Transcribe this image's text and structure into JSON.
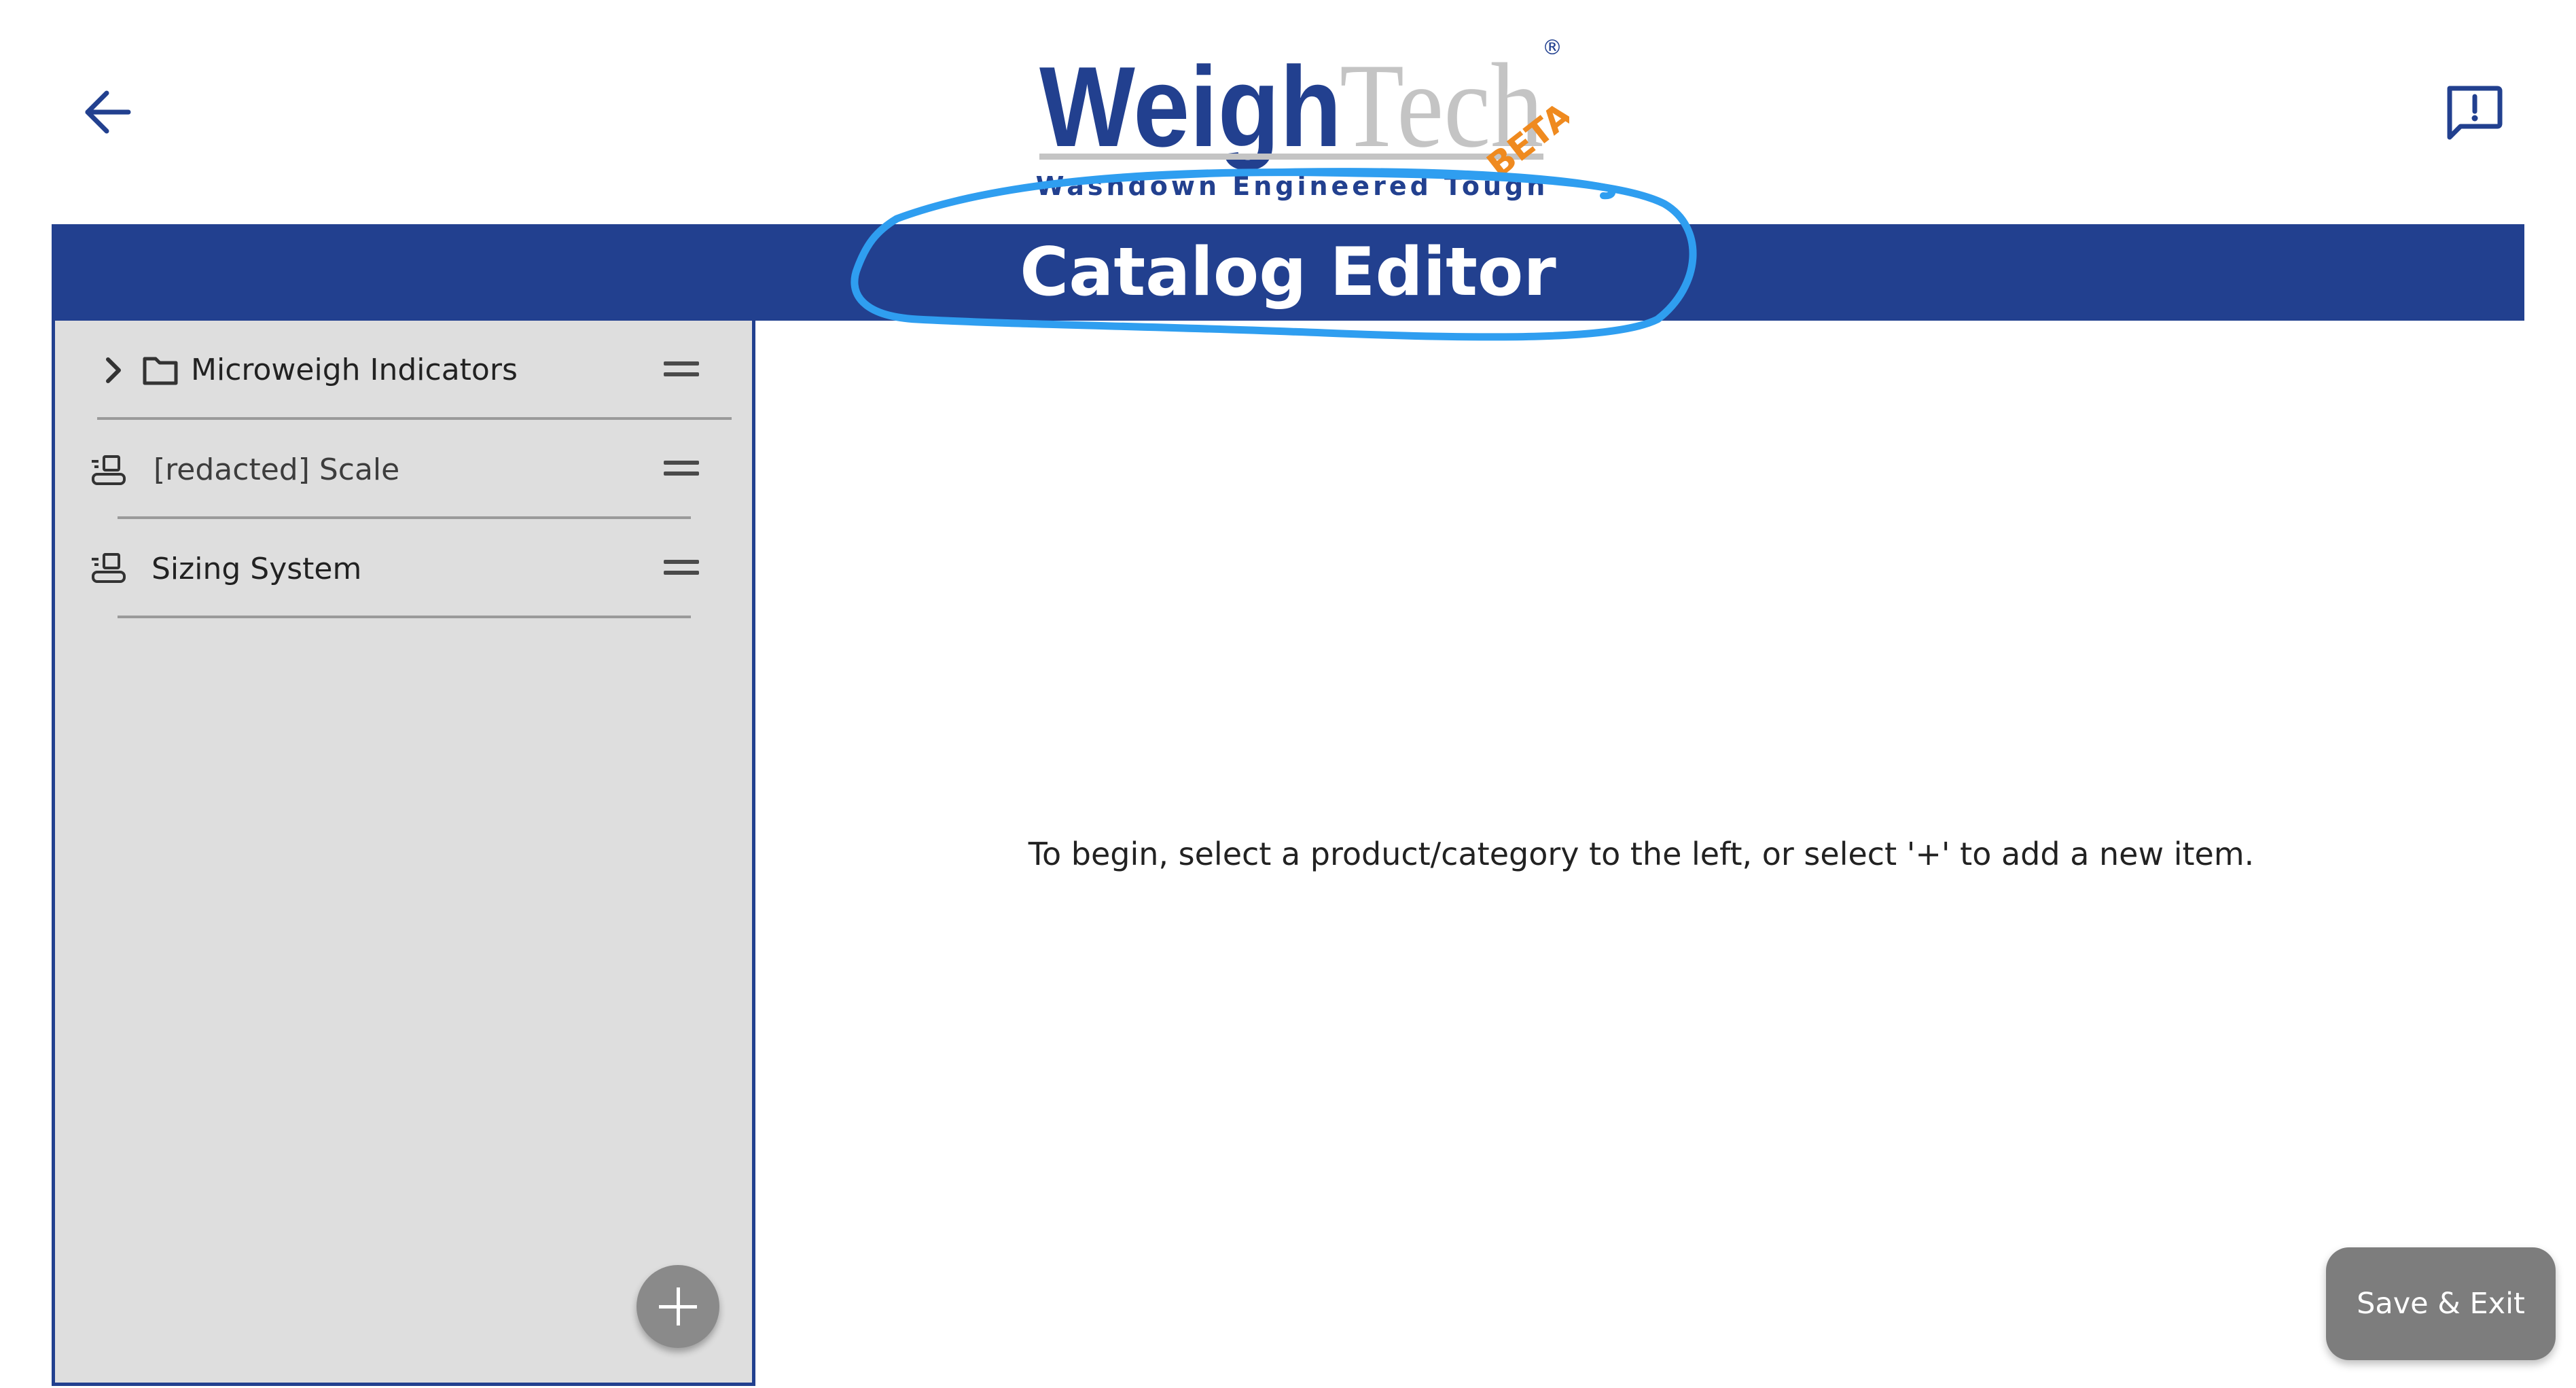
{
  "header": {
    "back_icon": "arrow-left-icon",
    "feedback_icon": "feedback-chat-icon",
    "logo": {
      "brand_primary": "Weigh",
      "brand_secondary": "Tech",
      "registered_mark": "®",
      "badge": "BETA",
      "tagline": "Washdown Engineered Tough"
    },
    "accent_color": "#22408f"
  },
  "title_bar": {
    "title": "Catalog Editor"
  },
  "sidebar": {
    "items": [
      {
        "label": "Microweigh Indicators",
        "type": "category",
        "icon": "folder-icon",
        "expand_icon": "chevron-right-icon"
      },
      {
        "label": "[redacted] Scale",
        "type": "product",
        "icon": "product-scale-icon"
      },
      {
        "label": "Sizing System",
        "type": "product",
        "icon": "product-scale-icon"
      }
    ],
    "add_button_icon": "plus-icon"
  },
  "main": {
    "instruction": "To begin, select a product/category to the left, or select '+' to add a new item."
  },
  "footer": {
    "save_exit_label": "Save & Exit"
  }
}
